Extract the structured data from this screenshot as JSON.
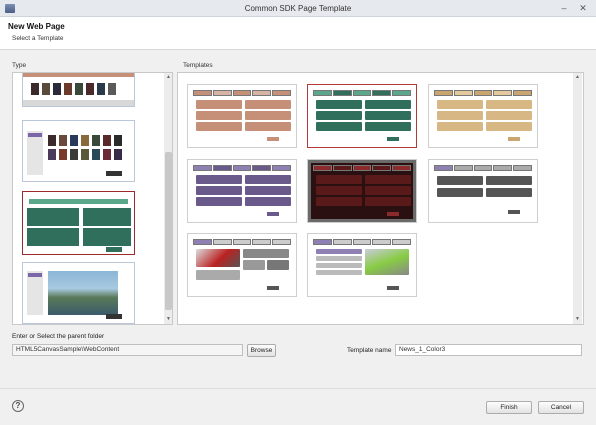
{
  "window": {
    "title": "Common SDK Page Template"
  },
  "header": {
    "title": "New Web Page",
    "subtitle": "Select a Template"
  },
  "type_panel": {
    "label": "Type"
  },
  "templates_panel": {
    "label": "Templates"
  },
  "folder": {
    "label": "Enter or Select the parent folder",
    "value": "HTML5CanvasSample\\WebContent",
    "browse_label": "Browse"
  },
  "template_name": {
    "label": "Template name",
    "value": "News_1_Color3"
  },
  "buttons": {
    "finish": "Finish",
    "cancel": "Cancel"
  },
  "icons": {
    "help": "?",
    "minimize": "–",
    "close": "✕",
    "scroll_up": "▲",
    "scroll_down": "▼"
  },
  "colors": {
    "selection_border": "#b33939",
    "accent_green": "#2f6f5c",
    "accent_purple": "#6a5a8c",
    "accent_tan": "#c9a670",
    "accent_salmon": "#c58f78",
    "accent_darkred": "#5a1a1a"
  }
}
